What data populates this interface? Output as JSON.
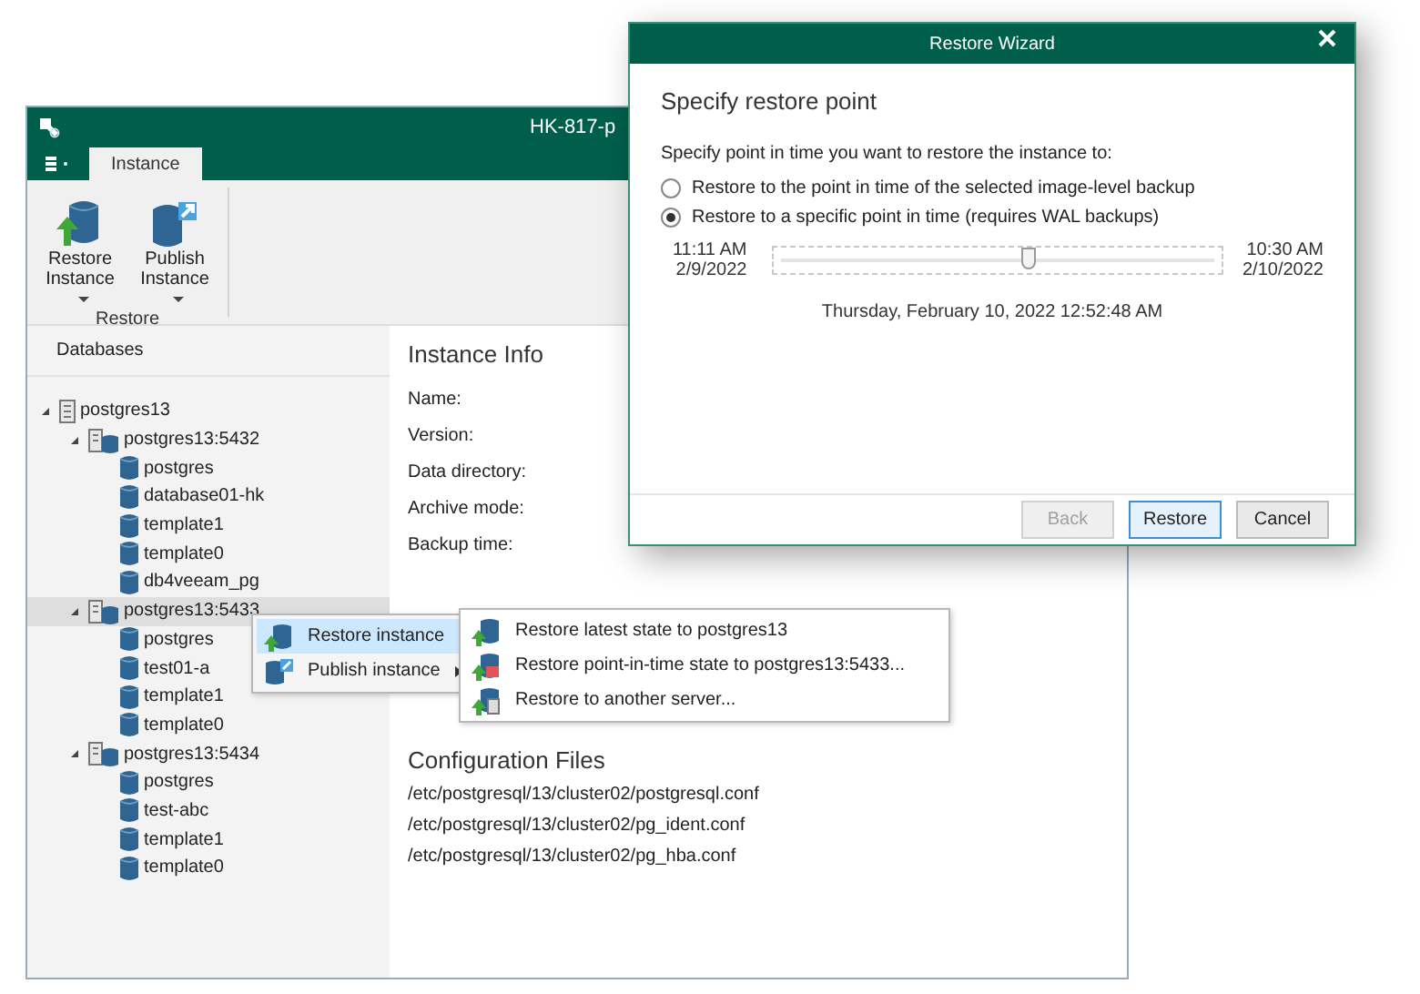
{
  "main_window": {
    "title": "HK-817-p",
    "ribbon": {
      "tabs": [
        {
          "label": "Instance",
          "selected": true
        }
      ],
      "buttons": [
        {
          "label": "Restore Instance",
          "kind": "restore"
        },
        {
          "label": "Publish Instance",
          "kind": "publish"
        }
      ],
      "group_label": "Restore"
    },
    "sidebar": {
      "title": "Databases",
      "tree": [
        {
          "label": "postgres13",
          "kind": "server",
          "expanded": true,
          "selected": false,
          "children": [
            {
              "label": "postgres13:5432",
              "kind": "instance",
              "expanded": true,
              "selected": false,
              "children": [
                {
                  "label": "postgres",
                  "kind": "database",
                  "selected": false
                },
                {
                  "label": "database01-hk",
                  "kind": "database",
                  "selected": false
                },
                {
                  "label": "template1",
                  "kind": "database",
                  "selected": false
                },
                {
                  "label": "template0",
                  "kind": "database",
                  "selected": false
                },
                {
                  "label": "db4veeam_pg",
                  "kind": "database",
                  "selected": false
                }
              ]
            },
            {
              "label": "postgres13:5433",
              "kind": "instance",
              "expanded": true,
              "selected": true,
              "children": [
                {
                  "label": "postgres",
                  "kind": "database",
                  "selected": false
                },
                {
                  "label": "test01-a",
                  "kind": "database",
                  "selected": false
                },
                {
                  "label": "template1",
                  "kind": "database",
                  "selected": false
                },
                {
                  "label": "template0",
                  "kind": "database",
                  "selected": false
                }
              ]
            },
            {
              "label": "postgres13:5434",
              "kind": "instance",
              "expanded": true,
              "selected": false,
              "children": [
                {
                  "label": "postgres",
                  "kind": "database",
                  "selected": false
                },
                {
                  "label": "test-abc",
                  "kind": "database",
                  "selected": false
                },
                {
                  "label": "template1",
                  "kind": "database",
                  "selected": false
                },
                {
                  "label": "template0",
                  "kind": "database",
                  "selected": false
                }
              ]
            }
          ]
        }
      ]
    },
    "details": {
      "title": "Instance Info",
      "fields": [
        "Name:",
        "Version:",
        "Data directory:",
        "Archive mode:",
        "Backup time:"
      ],
      "config_title": "Configuration Files",
      "config_files": [
        "/etc/postgresql/13/cluster02/postgresql.conf",
        "/etc/postgresql/13/cluster02/pg_ident.conf",
        "/etc/postgresql/13/cluster02/pg_hba.conf"
      ]
    }
  },
  "context_menu": {
    "items": [
      {
        "label": "Restore instance",
        "kind": "restore",
        "selected": true
      },
      {
        "label": "Publish instance",
        "kind": "publish",
        "selected": false
      }
    ]
  },
  "submenu": {
    "items": [
      {
        "label": "Restore latest state to postgres13",
        "kind": "latest"
      },
      {
        "label": "Restore point-in-time state to postgres13:5433...",
        "kind": "point"
      },
      {
        "label": "Restore to another server...",
        "kind": "server"
      }
    ]
  },
  "wizard": {
    "title": "Restore Wizard",
    "heading": "Specify restore point",
    "prompt": "Specify point in time you want to restore the instance to:",
    "options": [
      {
        "label": "Restore to the point in time of the selected image-level backup",
        "selected": false
      },
      {
        "label": "Restore to a specific point in time (requires WAL backups)",
        "selected": true
      }
    ],
    "slider": {
      "start_time": "11:11 AM",
      "start_date": "2/9/2022",
      "end_time": "10:30 AM",
      "end_date": "2/10/2022",
      "level": 0.57
    },
    "selected_time": "Thursday, February 10, 2022 12:52:48 AM",
    "buttons": [
      {
        "label": "Back",
        "disabled": true,
        "default": false
      },
      {
        "label": "Restore",
        "disabled": false,
        "default": true
      },
      {
        "label": "Cancel",
        "disabled": false,
        "default": false
      }
    ]
  }
}
